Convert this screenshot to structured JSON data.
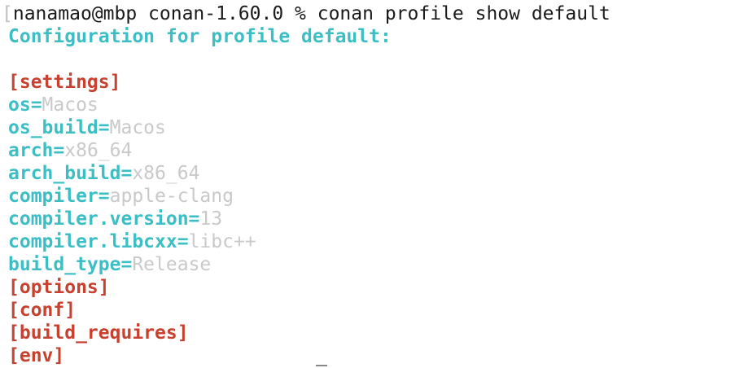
{
  "terminal": {
    "prompt_bracket": "[",
    "prompt": "nanamao@mbp conan-1.60.0 % ",
    "command": "conan profile show default",
    "header": "Configuration for profile default:",
    "sections": [
      {
        "name": "[settings]",
        "entries": [
          {
            "key": "os=",
            "value": "Macos"
          },
          {
            "key": "os_build=",
            "value": "Macos"
          },
          {
            "key": "arch=",
            "value": "x86_64"
          },
          {
            "key": "arch_build=",
            "value": "x86_64"
          },
          {
            "key": "compiler=",
            "value": "apple-clang"
          },
          {
            "key": "compiler.version=",
            "value": "13"
          },
          {
            "key": "compiler.libcxx=",
            "value": "libc++"
          },
          {
            "key": "build_type=",
            "value": "Release"
          }
        ]
      },
      {
        "name": "[options]",
        "entries": []
      },
      {
        "name": "[conf]",
        "entries": []
      },
      {
        "name": "[build_requires]",
        "entries": []
      },
      {
        "name": "[env]",
        "entries": []
      }
    ]
  },
  "colors": {
    "key": "#3bbfc4",
    "section": "#c8402e",
    "value": "#c9c9c9",
    "text": "#1a1a1a"
  }
}
